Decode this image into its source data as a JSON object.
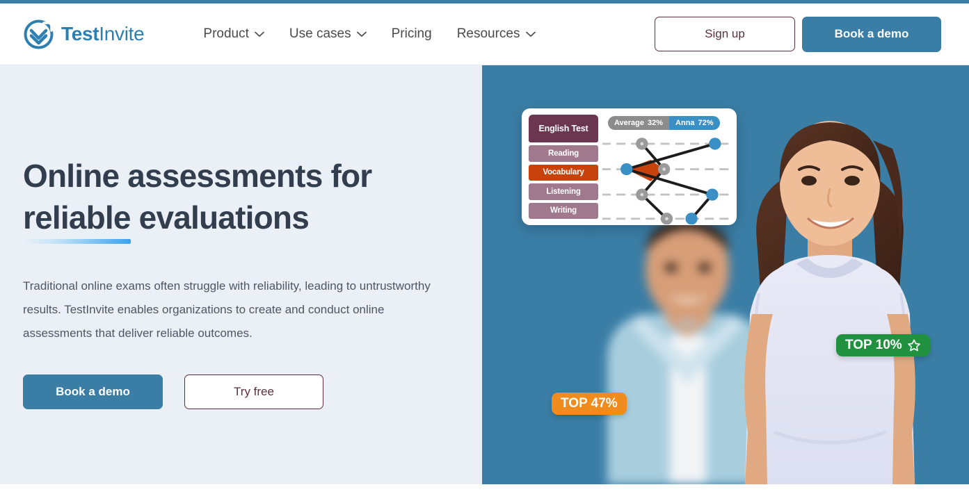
{
  "brand": {
    "name_bold": "Test",
    "name_light": "Invite",
    "logo_icon": "check-circle-icon",
    "color": "#2d7fb0"
  },
  "header": {
    "nav": [
      {
        "label": "Product",
        "has_dropdown": true,
        "icon": "chevron-down-icon"
      },
      {
        "label": "Use cases",
        "has_dropdown": true,
        "icon": "chevron-down-icon"
      },
      {
        "label": "Pricing",
        "has_dropdown": false
      },
      {
        "label": "Resources",
        "has_dropdown": true,
        "icon": "chevron-down-icon"
      }
    ],
    "sign_up_label": "Sign up",
    "book_demo_label": "Book a demo",
    "accent_color": "#3a7da5",
    "outline_color": "#5c2f3f"
  },
  "hero": {
    "headline_line1": "Online assessments for",
    "headline_underlined": "reliable",
    "headline_line2_rest": " evaluations",
    "paragraph": "Traditional online exams often struggle with reliability, leading to untrustworthy results. TestInvite enables organizations to create and conduct online assessments that deliver reliable outcomes.",
    "primary_cta": "Book a demo",
    "secondary_cta": "Try free",
    "left_bg": "#ebf0f7",
    "right_bg": "#3a7da5"
  },
  "result_card": {
    "title": "English Test",
    "sections": [
      {
        "label": "Reading",
        "active": false
      },
      {
        "label": "Vocabulary",
        "active": true
      },
      {
        "label": "Listening",
        "active": false
      },
      {
        "label": "Writing",
        "active": false
      }
    ],
    "legend": [
      {
        "name": "Average",
        "value": "32%",
        "color": "#8c8c8c"
      },
      {
        "name": "Anna",
        "value": "72%",
        "color": "#3a8fc4"
      }
    ],
    "active_color": "#c8430c",
    "row_color": "#a1798c",
    "title_color": "#6b3650"
  },
  "badges": [
    {
      "label": "TOP 47%",
      "color": "#f08b1d",
      "icon": null
    },
    {
      "label": "TOP 10%",
      "color": "#20923f",
      "icon": "star-icon"
    }
  ],
  "chart_data": {
    "type": "line",
    "title": "English Test",
    "categories": [
      "Reading",
      "Vocabulary",
      "Listening",
      "Writing"
    ],
    "series": [
      {
        "name": "Average",
        "value_label": "32%",
        "color": "#8c8c8c",
        "points": [
          [
            0.3,
            0.08
          ],
          [
            0.62,
            0.4
          ],
          [
            0.3,
            0.7
          ],
          [
            0.5,
            0.97
          ]
        ]
      },
      {
        "name": "Anna",
        "value_label": "72%",
        "color": "#3a8fc4",
        "points": [
          [
            0.88,
            0.08
          ],
          [
            0.18,
            0.4
          ],
          [
            0.86,
            0.7
          ],
          [
            0.7,
            0.97
          ]
        ]
      }
    ],
    "grid": true,
    "gridline_style": "dashed",
    "legend_position": "top-left",
    "highlight_region_color": "#c8430c",
    "xlabel": "",
    "ylabel": ""
  }
}
